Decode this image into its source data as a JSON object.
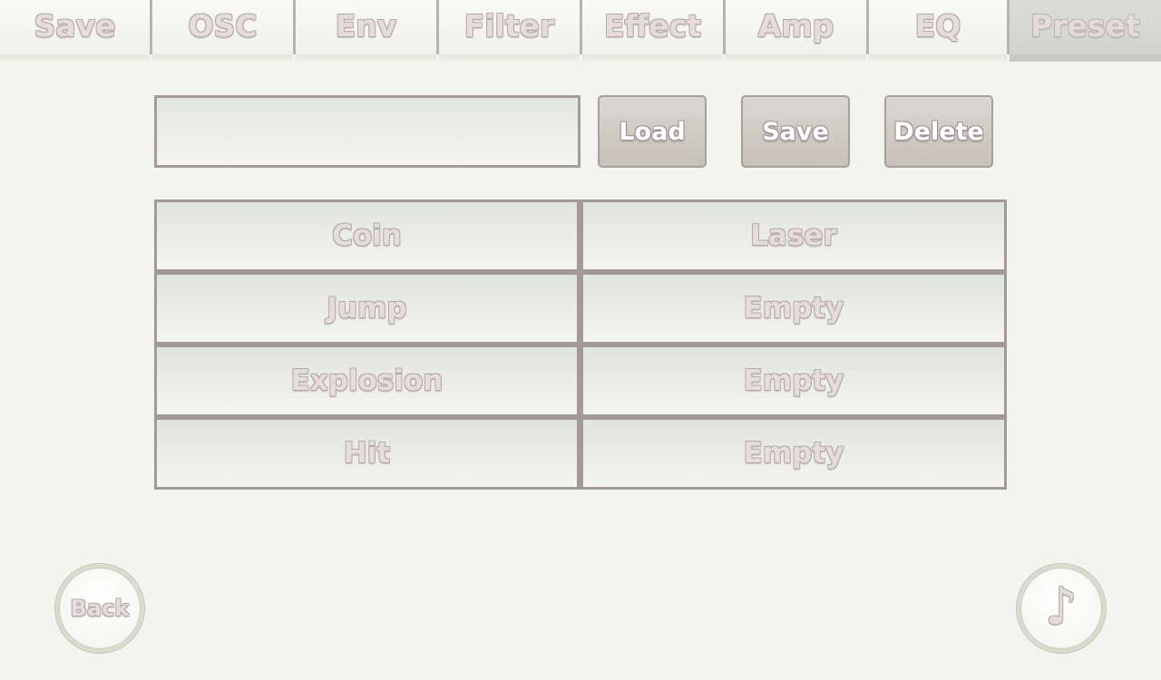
{
  "tabs": [
    {
      "label": "Save",
      "active": false
    },
    {
      "label": "OSC",
      "active": false
    },
    {
      "label": "Env",
      "active": false
    },
    {
      "label": "Filter",
      "active": false
    },
    {
      "label": "Effect",
      "active": false
    },
    {
      "label": "Amp",
      "active": false
    },
    {
      "label": "EQ",
      "active": false
    },
    {
      "label": "Preset",
      "active": true
    }
  ],
  "preset_name": {
    "value": "",
    "placeholder": ""
  },
  "actions": {
    "load_label": "Load",
    "save_label": "Save",
    "delete_label": "Delete"
  },
  "presets": [
    {
      "left": "Coin",
      "right": "Laser"
    },
    {
      "left": "Jump",
      "right": "Empty"
    },
    {
      "left": "Explosion",
      "right": "Empty"
    },
    {
      "left": "Hit",
      "right": "Empty"
    }
  ],
  "footer": {
    "back_label": "Back",
    "play_icon": "music-note-icon",
    "play_glyph": "♪"
  }
}
